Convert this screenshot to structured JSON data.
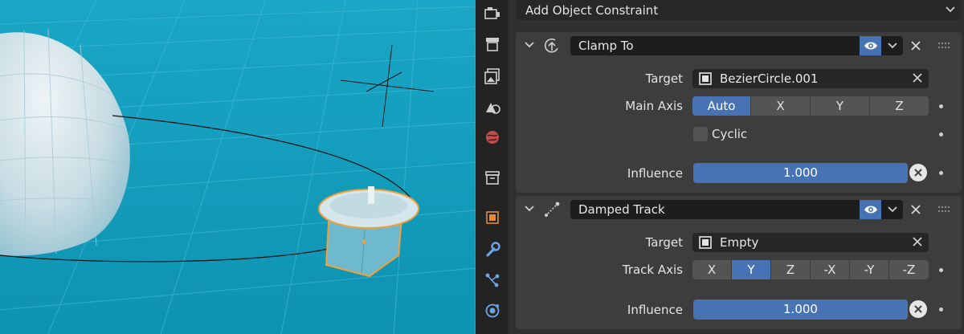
{
  "properties_editor": {
    "add_constraint_label": "Add Object Constraint",
    "constraints": [
      {
        "name": "Clamp To",
        "type_icon": "clamp-to-icon",
        "target": "BezierCircle.001",
        "main_axis_label": "Main Axis",
        "main_axis_options": [
          "Auto",
          "X",
          "Y",
          "Z"
        ],
        "main_axis_selected": "Auto",
        "cyclic_label": "Cyclic",
        "cyclic_checked": false,
        "influence_label": "Influence",
        "influence": "1.000",
        "influence_fraction": 1.0
      },
      {
        "name": "Damped Track",
        "type_icon": "damped-track-icon",
        "target": "Empty",
        "track_axis_label": "Track Axis",
        "track_axis_options": [
          "X",
          "Y",
          "Z",
          "-X",
          "-Y",
          "-Z"
        ],
        "track_axis_selected": "Y",
        "influence_label": "Influence",
        "influence": "1.000",
        "influence_fraction": 1.0
      }
    ],
    "target_label": "Target"
  },
  "tabs": [
    "tool-icon",
    "render-icon",
    "output-icon",
    "view-layer-icon",
    "scene-icon",
    "world-icon",
    "collection-icon",
    "object-icon",
    "modifier-icon",
    "particles-icon",
    "physics-icon"
  ],
  "colors": {
    "accent": "#4772b3",
    "viewport_bg": "#139ab8",
    "selection_outline": "#f0a13a",
    "panel_bg": "#3d3d3d"
  }
}
